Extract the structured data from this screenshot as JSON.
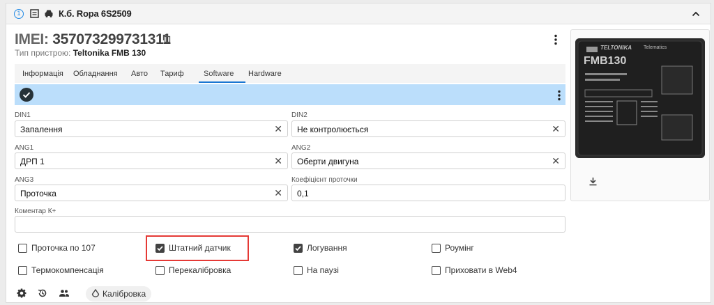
{
  "header": {
    "index": "1",
    "vehicle_name": "К.б. Ropa 6S2509"
  },
  "device": {
    "imei_label": "IMEI:",
    "imei_value": "357073299731311",
    "type_label": "Тип пристрою:",
    "type_value": "Teltonika FMB 130"
  },
  "tabs": [
    {
      "label": "Інформація"
    },
    {
      "label": "Обладнання"
    },
    {
      "label": "Авто"
    },
    {
      "label": "Тариф"
    },
    {
      "label": "Software"
    },
    {
      "label": "Hardware"
    }
  ],
  "active_tab": "Software",
  "fields": {
    "din1": {
      "label": "DIN1",
      "value": "Запалення"
    },
    "din2": {
      "label": "DIN2",
      "value": "Не контролюється"
    },
    "ang1": {
      "label": "ANG1",
      "value": "ДРП 1"
    },
    "ang2": {
      "label": "ANG2",
      "value": "Оберти двигуна"
    },
    "ang3": {
      "label": "ANG3",
      "value": "Проточка"
    },
    "coef": {
      "label": "Коефіцієнт проточки",
      "value": "0,1"
    },
    "comment": {
      "label": "Коментар К+",
      "value": ""
    }
  },
  "checkboxes": [
    {
      "label": "Проточка по 107",
      "checked": false
    },
    {
      "label": "Штатний датчик",
      "checked": true
    },
    {
      "label": "Логування",
      "checked": true
    },
    {
      "label": "Роумінг",
      "checked": false
    },
    {
      "label": "Термокомпенсація",
      "checked": false
    },
    {
      "label": "Перекалібровка",
      "checked": false
    },
    {
      "label": "На паузі",
      "checked": false
    },
    {
      "label": "Приховати в Web4",
      "checked": false
    }
  ],
  "footer": {
    "calibration_label": "Калібровка"
  },
  "device_image": {
    "brand": "TELTONIKA",
    "brand_sub": "Telematics",
    "model": "FMB130"
  },
  "colors": {
    "accent": "#1976d2",
    "status_bar": "#bbdefb",
    "highlight": "#e53935"
  }
}
